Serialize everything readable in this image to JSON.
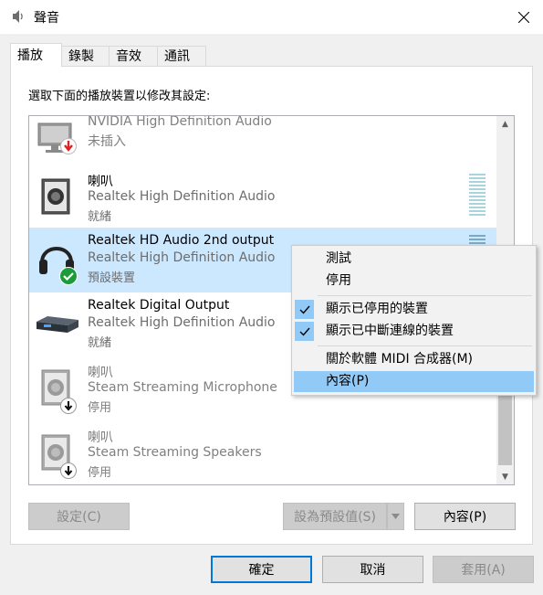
{
  "window": {
    "title": "聲音",
    "icon": "speaker-icon"
  },
  "tabs": [
    {
      "label": "播放",
      "active": true
    },
    {
      "label": "錄製",
      "active": false
    },
    {
      "label": "音效",
      "active": false
    },
    {
      "label": "通訊",
      "active": false
    }
  ],
  "instruction": "選取下面的播放裝置以修改其設定:",
  "devices": [
    {
      "name": "NVIDIA High Definition Audio",
      "desc": "",
      "status": "未插入",
      "icon": "monitor-icon",
      "badge": "unplugged-badge-icon",
      "dimmed": true
    },
    {
      "name": "喇叭",
      "desc": "Realtek High Definition Audio",
      "status": "就緒",
      "icon": "speaker-icon",
      "badge": "",
      "dimmed": false
    },
    {
      "name": "Realtek HD Audio 2nd output",
      "desc": "Realtek High Definition Audio",
      "status": "預設裝置",
      "icon": "headphones-icon",
      "badge": "default-check-badge-icon",
      "dimmed": false,
      "selected": true
    },
    {
      "name": "Realtek Digital Output",
      "desc": "Realtek High Definition Audio",
      "status": "就緒",
      "icon": "digital-receiver-icon",
      "badge": "",
      "dimmed": false
    },
    {
      "name": "喇叭",
      "desc": "Steam Streaming Microphone",
      "status": "停用",
      "icon": "speaker-icon",
      "badge": "disabled-badge-icon",
      "dimmed": true
    },
    {
      "name": "喇叭",
      "desc": "Steam Streaming Speakers",
      "status": "停用",
      "icon": "speaker-icon",
      "badge": "disabled-badge-icon",
      "dimmed": true
    }
  ],
  "context_menu": [
    {
      "label": "測試",
      "checked": false
    },
    {
      "label": "停用",
      "checked": false
    },
    {
      "label": "顯示已停用的裝置",
      "checked": true
    },
    {
      "label": "顯示已中斷連線的裝置",
      "checked": true
    },
    {
      "label": "關於軟體 MIDI 合成器(M)",
      "checked": false
    },
    {
      "label": "內容(P)",
      "checked": false,
      "highlighted": true
    }
  ],
  "buttons": {
    "configure": "設定(C)",
    "set_default": "設為預設值(S)",
    "properties": "內容(P)",
    "ok": "確定",
    "cancel": "取消",
    "apply": "套用(A)"
  },
  "colors": {
    "selection": "#cce8ff",
    "menu_highlight": "#91c9f7",
    "default_button_border": "#0078d7",
    "check_green": "#1e9a3a",
    "red_arrow": "#d9232a"
  }
}
